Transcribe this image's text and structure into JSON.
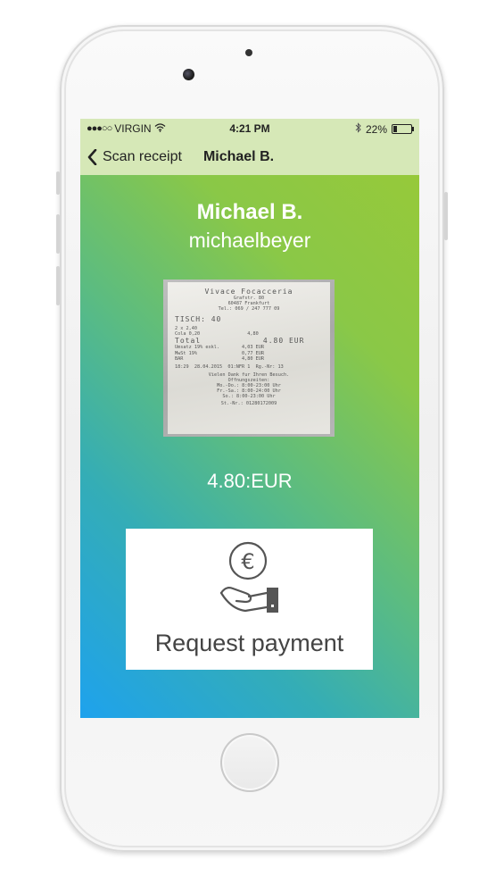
{
  "status_bar": {
    "signal": "●●●○○",
    "carrier": "VIRGIN",
    "wifi_icon": "wifi-icon",
    "time": "4:21 PM",
    "bluetooth_icon": "bluetooth-icon",
    "battery_percent": "22%",
    "battery_level": 0.22
  },
  "nav": {
    "back_label": "Scan receipt",
    "title": "Michael B."
  },
  "profile": {
    "display_name": "Michael B.",
    "username": "michaelbeyer"
  },
  "receipt_text": {
    "title": "Vivace Focacceria",
    "address1": "Grafstr. 80",
    "address2": "60487 Frankfurt",
    "phone": "Tel.: 069 / 247 777 09",
    "table": "TISCH: 40",
    "item1": "2 x 2,40",
    "item2": "Cola 0,20                 4,80",
    "total": "Total            4.80 EUR",
    "tax1": "Umsatz 19% exkl.        4,03 EUR",
    "tax2": "MwSt 19%                0,77 EUR",
    "cash": "BAR                     4,80 EUR",
    "date": "18:29  28.04.2015  01:NFR 1  Rg.-Nr: 13",
    "thanks": "Vielen Dank fur Ihren Besuch.",
    "hours_title": "Offnungszeiten:",
    "hours1": "Mo.-Do.: 8:00-23:00 Uhr",
    "hours2": "Fr.-Sa.: 8:00-24:00 Uhr",
    "hours3": "So.: 8:00-23:00 Uhr",
    "tax_no": "St.-Nr.: 01280172009"
  },
  "amount": "4.80:EUR",
  "request_payment": {
    "icon": "euro-hand-icon",
    "symbol": "€",
    "label": "Request payment"
  },
  "colors": {
    "nav_background": "#d6e8b7",
    "gradient_top_right": "#96c93a",
    "gradient_bottom_left": "#1ea2ed",
    "card_background": "#ffffff",
    "card_text": "#444444"
  }
}
